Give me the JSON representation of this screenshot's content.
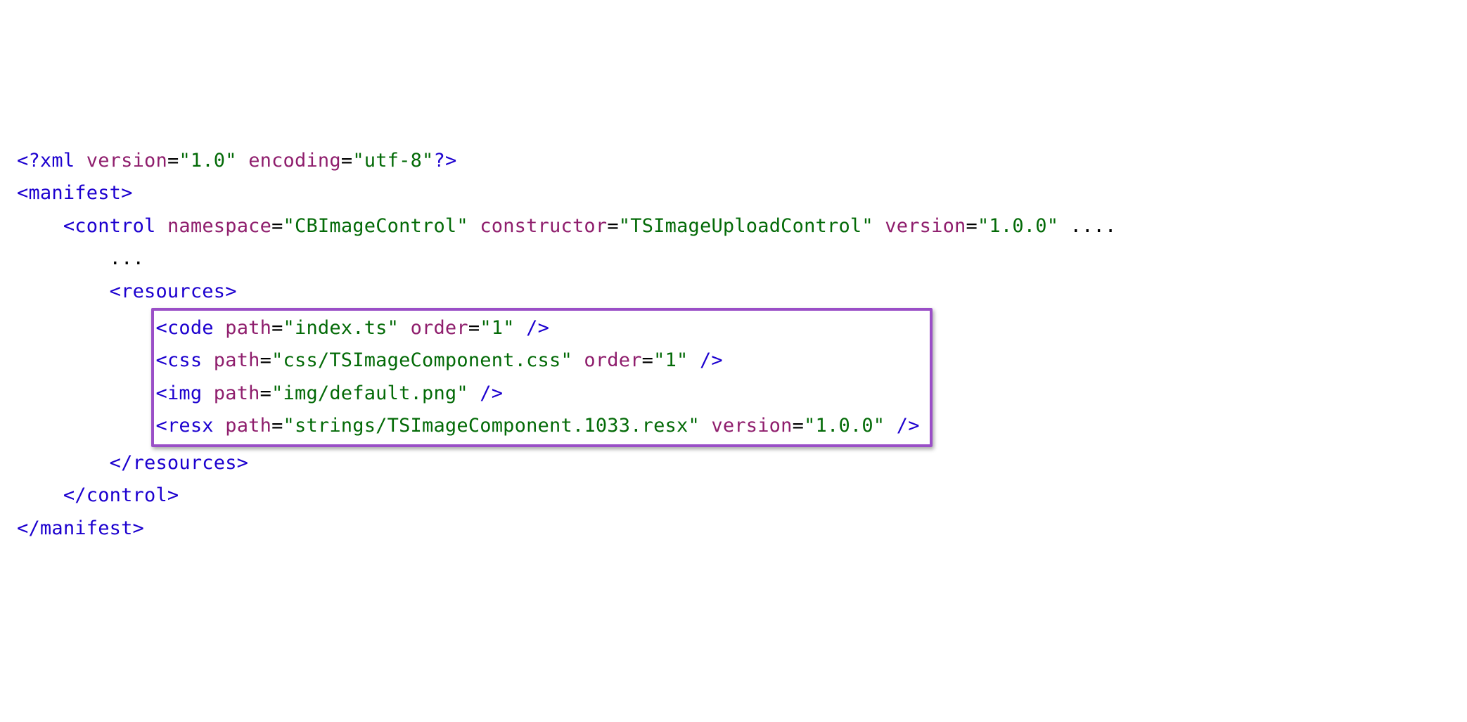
{
  "xml_decl": {
    "open": "<?",
    "name": "xml",
    "attrs": [
      {
        "name": "version",
        "value": "\"1.0\""
      },
      {
        "name": "encoding",
        "value": "\"utf-8\""
      }
    ],
    "close": "?>"
  },
  "manifest": {
    "open": "<manifest>",
    "close": "</manifest>"
  },
  "control": {
    "open_lt": "<",
    "name": "control",
    "attrs": [
      {
        "name": "namespace",
        "value": "\"CBImageControl\""
      },
      {
        "name": "constructor",
        "value": "\"TSImageUploadControl\""
      },
      {
        "name": "version",
        "value": "\"1.0.0\""
      }
    ],
    "trail": "....",
    "close": "</control>"
  },
  "body_ellipsis": "...",
  "resources": {
    "open": "<resources>",
    "close": "</resources>"
  },
  "res_items": [
    {
      "tag": "code",
      "attrs": [
        {
          "name": "path",
          "value": "\"index.ts\""
        },
        {
          "name": "order",
          "value": "\"1\""
        }
      ]
    },
    {
      "tag": "css",
      "attrs": [
        {
          "name": "path",
          "value": "\"css/TSImageComponent.css\""
        },
        {
          "name": "order",
          "value": "\"1\""
        }
      ]
    },
    {
      "tag": "img",
      "attrs": [
        {
          "name": "path",
          "value": "\"img/default.png\""
        }
      ]
    },
    {
      "tag": "resx",
      "attrs": [
        {
          "name": "path",
          "value": "\"strings/TSImageComponent.1033.resx\""
        },
        {
          "name": "version",
          "value": "\"1.0.0\""
        }
      ]
    }
  ],
  "indent": {
    "i1": "    ",
    "i2": "        ",
    "i3": "            "
  },
  "sym": {
    "lt": "<",
    "gt": ">",
    "selfclose": " />"
  }
}
